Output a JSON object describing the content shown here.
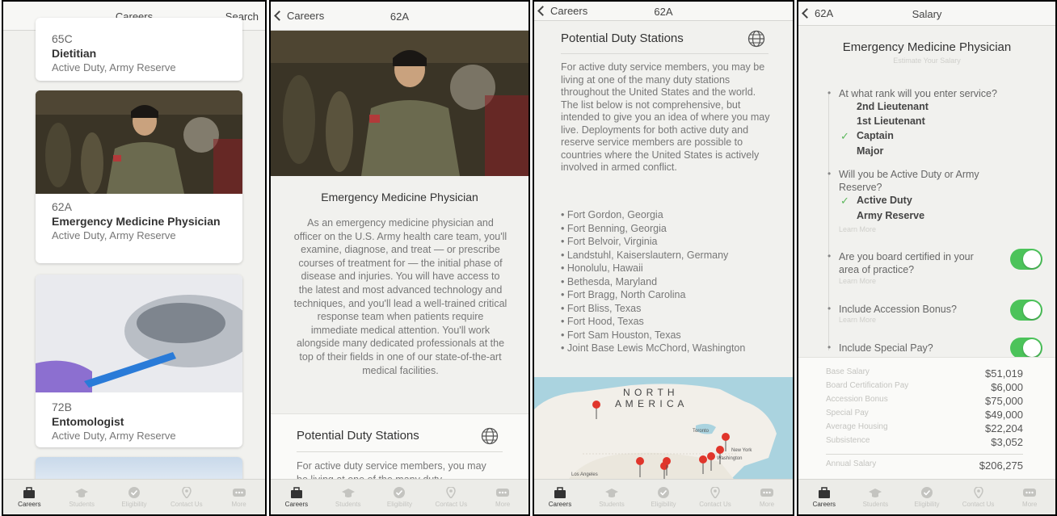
{
  "screens": {
    "careers": {
      "title": "Careers",
      "search": "Search",
      "cards": [
        {
          "code": "65C",
          "name": "Dietitian",
          "duty": "Active Duty, Army Reserve"
        },
        {
          "code": "62A",
          "name": "Emergency Medicine Physician",
          "duty": "Active Duty, Army Reserve"
        },
        {
          "code": "72B",
          "name": "Entomologist",
          "duty": "Active Duty, Army Reserve"
        }
      ]
    },
    "detail": {
      "back": "Careers",
      "title": "62A",
      "heading": "Emergency Medicine Physician",
      "description": "As an emergency medicine physician and officer on the U.S. Army health care team, you'll examine, diagnose, and treat — or prescribe courses of treatment for — the initial phase of disease and injuries. You will have access to the latest and most advanced technology and techniques, and you'll lead a well-trained critical response team when patients require immediate medical attention. You'll work alongside many dedicated professionals at the top of their fields in one of our state-of-the-art medical facilities.",
      "stations_heading": "Potential Duty Stations",
      "stations_teaser": "For active duty service members, you may be living at one of the many duty"
    },
    "stations": {
      "back": "Careers",
      "title": "62A",
      "heading": "Potential Duty Stations",
      "intro": "For active duty service members, you may be living at one of the many duty stations throughout the United States and the world. The list below is not comprehensive, but intended to give you an idea of where you may live. Deployments for both active duty and reserve service members are possible to countries where the United States is actively involved in armed conflict.",
      "list": [
        "Fort Gordon, Georgia",
        "Fort Benning, Georgia",
        "Fort Belvoir, Virginia",
        "Landstuhl, Kaiserslautern, Germany",
        "Honolulu, Hawaii",
        "Bethesda, Maryland",
        "Fort Bragg, North Carolina",
        "Fort Bliss, Texas",
        "Fort Hood, Texas",
        "Fort Sam Houston, Texas",
        "Joint Base Lewis McChord, Washington"
      ],
      "map": {
        "line1": "N O R T H",
        "line2": "A M E R I C A",
        "toronto": "Toronto",
        "new_york": "New York",
        "washington": "Washington",
        "los_angeles": "Los Angeles"
      }
    },
    "salary": {
      "back": "62A",
      "title": "Salary",
      "heading": "Emergency Medicine Physician",
      "subheading": "Estimate Your Salary",
      "q_rank": "At what rank will you enter service?",
      "ranks": [
        "2nd Lieutenant",
        "1st Lieutenant",
        "Captain",
        "Major"
      ],
      "selected_rank": "Captain",
      "q_duty": "Will you be Active Duty or Army Reserve?",
      "duty_options": [
        "Active Duty",
        "Army Reserve"
      ],
      "selected_duty": "Active Duty",
      "learn_more": "Learn More",
      "q_board": "Are you board certified in your area of practice?",
      "q_accession": "Include Accession Bonus?",
      "q_special": "Include Special Pay?",
      "toggles": {
        "board": true,
        "accession": true,
        "special": true
      },
      "check_mark": "✓",
      "summary": [
        {
          "label": "Base Salary",
          "value": "$51,019"
        },
        {
          "label": "Board Certification Pay",
          "value": "$6,000"
        },
        {
          "label": "Accession Bonus",
          "value": "$75,000"
        },
        {
          "label": "Special Pay",
          "value": "$49,000"
        },
        {
          "label": "Average Housing",
          "value": "$22,204"
        },
        {
          "label": "Subsistence",
          "value": "$3,052"
        }
      ],
      "annual_label": "Annual Salary",
      "annual_value": "$206,275"
    }
  },
  "tabs": [
    "Careers",
    "Students",
    "Eligibility",
    "Contact Us",
    "More"
  ],
  "colors": {
    "toggle_on": "#4cc35a",
    "check": "#5cb85c",
    "pin": "#e0352b"
  }
}
